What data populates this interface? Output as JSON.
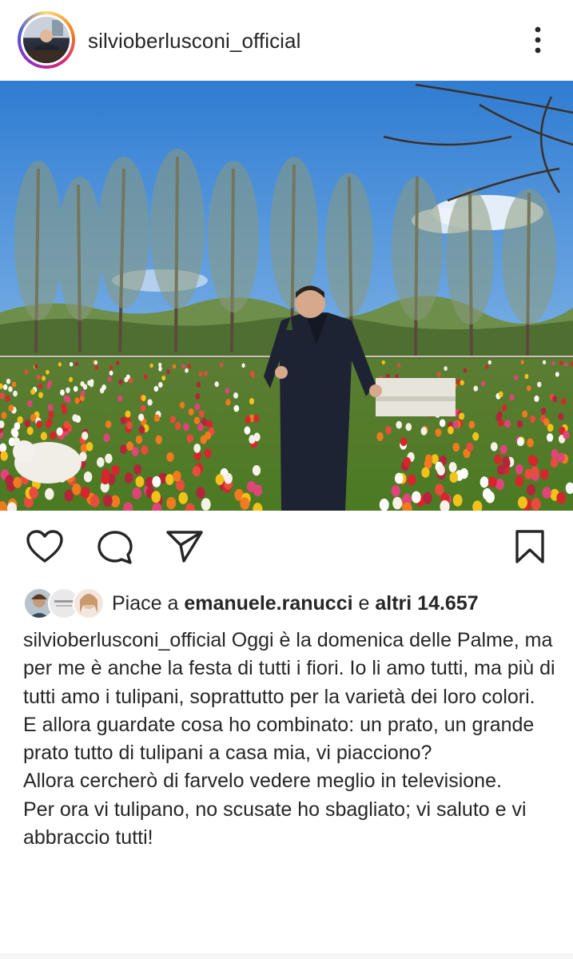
{
  "post": {
    "username": "silvioberlusconi_official",
    "more_icon": "more-vertical-icon",
    "likes": {
      "prefix": "Piace a",
      "first_liker": "emanuele.ranucci",
      "connector": "e",
      "others": "altri 14.657"
    },
    "caption": {
      "username": "silvioberlusconi_official",
      "lines": [
        "Oggi è la domenica delle Palme, ma per me è anche la festa di tutti i fiori. Io li amo tutti, ma più di tutti amo i tulipani, soprattutto per la varietà dei loro colori.",
        "E allora guardate cosa ho combinato: un prato, un grande prato tutto di tulipani a casa mia, vi piacciono?",
        "Allora cercherò di farvelo vedere meglio in televisione.",
        "Per ora vi tulipano, no scusate ho sbagliato; vi saluto e vi abbraccio tutti!"
      ]
    },
    "actions": {
      "like_icon": "heart-icon",
      "comment_icon": "comment-icon",
      "share_icon": "send-icon",
      "save_icon": "bookmark-icon"
    },
    "colors": {
      "text": "#262626",
      "sky": "#3f86d6",
      "grass": "#4f7a2a"
    }
  }
}
